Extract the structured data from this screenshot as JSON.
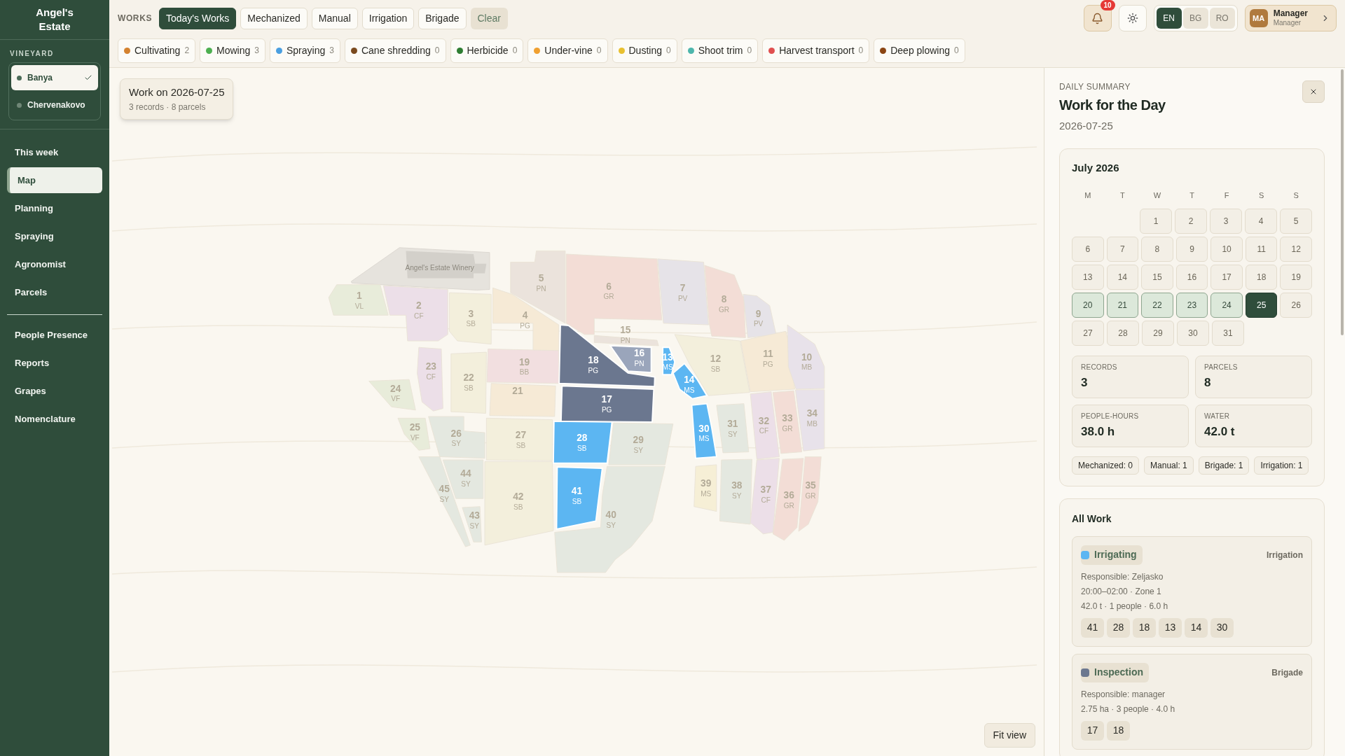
{
  "sidebar": {
    "brand": "Angel's Estate",
    "vineyard_label": "VINEYARD",
    "vineyards": [
      {
        "name": "Banya",
        "selected": true
      },
      {
        "name": "Chervenakovo",
        "selected": false
      }
    ],
    "nav_groups": [
      [
        {
          "label": "This week",
          "selected": false
        },
        {
          "label": "Map",
          "selected": true
        },
        {
          "label": "Planning",
          "selected": false
        },
        {
          "label": "Spraying",
          "selected": false
        },
        {
          "label": "Agronomist",
          "selected": false
        },
        {
          "label": "Parcels",
          "selected": false
        }
      ],
      [
        {
          "label": "People Presence",
          "selected": false
        },
        {
          "label": "Reports",
          "selected": false
        },
        {
          "label": "Grapes",
          "selected": false
        },
        {
          "label": "Nomenclature",
          "selected": false
        }
      ]
    ]
  },
  "topbar": {
    "works_label": "WORKS",
    "filters": [
      {
        "label": "Today's Works",
        "selected": true
      },
      {
        "label": "Mechanized",
        "selected": false
      },
      {
        "label": "Manual",
        "selected": false
      },
      {
        "label": "Irrigation",
        "selected": false
      },
      {
        "label": "Brigade",
        "selected": false
      }
    ],
    "clear": "Clear",
    "notifications": "10",
    "languages": [
      {
        "label": "EN",
        "selected": true
      },
      {
        "label": "BG",
        "selected": false
      },
      {
        "label": "RO",
        "selected": false
      }
    ],
    "user": {
      "initials": "MA",
      "name": "Manager",
      "role": "Manager"
    }
  },
  "categories": [
    {
      "label": "Cultivating",
      "count": "2",
      "color": "#d4822f"
    },
    {
      "label": "Mowing",
      "count": "3",
      "color": "#4caf50"
    },
    {
      "label": "Spraying",
      "count": "3",
      "color": "#4a9fe0"
    },
    {
      "label": "Cane shredding",
      "count": "0",
      "color": "#7a4a1e"
    },
    {
      "label": "Herbicide",
      "count": "0",
      "color": "#2e7d32"
    },
    {
      "label": "Under-vine",
      "count": "0",
      "color": "#f0a030"
    },
    {
      "label": "Dusting",
      "count": "0",
      "color": "#e8c030"
    },
    {
      "label": "Shoot trim",
      "count": "0",
      "color": "#4db6ac"
    },
    {
      "label": "Harvest transport",
      "count": "0",
      "color": "#e05050"
    },
    {
      "label": "Deep plowing",
      "count": "0",
      "color": "#8b4513"
    }
  ],
  "map": {
    "banner": {
      "title": "Work on 2026-07-25",
      "subtitle": "3 records · 8 parcels"
    },
    "winery": "Angel's Estate Winery",
    "parcels": [
      {
        "number": "1",
        "variety": "VL",
        "color": "#e8ecda",
        "active": false
      },
      {
        "number": "2",
        "variety": "CF",
        "color": "#ecdfe8",
        "active": false
      },
      {
        "number": "3",
        "variety": "SB",
        "color": "#f3efdc",
        "active": false
      },
      {
        "number": "4",
        "variety": "PG",
        "color": "#f6ead6",
        "active": false
      },
      {
        "number": "5",
        "variety": "PN",
        "color": "#ebe3dc",
        "active": false
      },
      {
        "number": "6",
        "variety": "GR",
        "color": "#f3ddd6",
        "active": false
      },
      {
        "number": "7",
        "variety": "PV",
        "color": "#e6e3e8",
        "active": false
      },
      {
        "number": "8",
        "variety": "GR",
        "color": "#f3ddd6",
        "active": false
      },
      {
        "number": "9",
        "variety": "PV",
        "color": "#e6e3e8",
        "active": false
      },
      {
        "number": "13",
        "variety": "MS",
        "color": "#5cb6f2",
        "active": true
      },
      {
        "number": "12",
        "variety": "SB",
        "color": "#f3efdc",
        "active": false
      },
      {
        "number": "11",
        "variety": "PG",
        "color": "#f6ead6",
        "active": false
      },
      {
        "number": "10",
        "variety": "MB",
        "color": "#e8e2ea",
        "active": false
      },
      {
        "number": "14",
        "variety": "MS",
        "color": "#5cb6f2",
        "active": true
      },
      {
        "number": "15",
        "variety": "PN",
        "color": "#ebe3dc",
        "active": false
      },
      {
        "number": "16",
        "variety": "PN",
        "color": "#9aa5bb",
        "active": true
      },
      {
        "number": "17",
        "variety": "PG",
        "color": "#6b778f",
        "active": true
      },
      {
        "number": "19",
        "variety": "BB",
        "color": "#f2dfe0",
        "active": false
      },
      {
        "number": "18",
        "variety": "PG",
        "color": "#6b778f",
        "active": true
      },
      {
        "number": "21",
        "color": "#f6ead6",
        "active": false
      },
      {
        "number": "22",
        "variety": "SB",
        "color": "#f3efdc",
        "active": false
      },
      {
        "number": "23",
        "variety": "CF",
        "color": "#ecdfe8",
        "active": false
      },
      {
        "number": "24",
        "variety": "VF",
        "color": "#e8ecda",
        "active": false
      },
      {
        "number": "25",
        "variety": "VF",
        "color": "#e8ecda",
        "active": false
      },
      {
        "number": "26",
        "variety": "SY",
        "color": "#e4e8e0",
        "active": false
      },
      {
        "number": "27",
        "variety": "SB",
        "color": "#f3efdc",
        "active": false
      },
      {
        "number": "28",
        "variety": "SB",
        "color": "#5cb6f2",
        "active": true
      },
      {
        "number": "29",
        "variety": "SY",
        "color": "#e4e8e0",
        "active": false
      },
      {
        "number": "30",
        "variety": "MS",
        "color": "#5cb6f2",
        "active": true
      },
      {
        "number": "31",
        "variety": "SY",
        "color": "#e4e8e0",
        "active": false
      },
      {
        "number": "32",
        "variety": "CF",
        "color": "#ecdfe8",
        "active": false
      },
      {
        "number": "33",
        "variety": "GR",
        "color": "#f3ddd6",
        "active": false
      },
      {
        "number": "34",
        "variety": "MB",
        "color": "#e8e2ea",
        "active": false
      },
      {
        "number": "45",
        "variety": "SY",
        "color": "#e4e8e0",
        "active": false
      },
      {
        "number": "44",
        "variety": "SY",
        "color": "#e4e8e0",
        "active": false
      },
      {
        "number": "43",
        "variety": "SY",
        "color": "#e4e8e0",
        "active": false
      },
      {
        "number": "42",
        "variety": "SB",
        "color": "#f3efdc",
        "active": false
      },
      {
        "number": "41",
        "variety": "SB",
        "color": "#5cb6f2",
        "active": true
      },
      {
        "number": "40",
        "variety": "SY",
        "color": "#e4e8e0",
        "active": false
      },
      {
        "number": "39",
        "variety": "MS",
        "color": "#f6efd6",
        "active": false
      },
      {
        "number": "38",
        "variety": "SY",
        "color": "#e4e8e0",
        "active": false
      },
      {
        "number": "37",
        "variety": "CF",
        "color": "#ecdfe8",
        "active": false
      },
      {
        "number": "36",
        "variety": "GR",
        "color": "#f3ddd6",
        "active": false
      },
      {
        "number": "35",
        "variety": "GR",
        "color": "#f3ddd6",
        "active": false
      }
    ],
    "fit_button": "Fit view"
  },
  "summary": {
    "eyebrow": "DAILY SUMMARY",
    "title": "Work for the Day",
    "date": "2026-07-25",
    "calendar": {
      "month": "July 2026",
      "weekdays": [
        "M",
        "T",
        "W",
        "T",
        "F",
        "S",
        "S"
      ],
      "weeks": [
        [
          {
            "day": "1",
            "selected": false,
            "in_week": false
          },
          {
            "day": "2",
            "selected": false,
            "in_week": false
          },
          {
            "day": "3",
            "selected": false,
            "in_week": false
          },
          {
            "day": "4",
            "selected": false,
            "in_week": false
          },
          {
            "day": "5",
            "selected": false,
            "in_week": false
          }
        ],
        [
          {
            "day": "6",
            "selected": false,
            "in_week": false
          },
          {
            "day": "7",
            "selected": false,
            "in_week": false
          },
          {
            "day": "8",
            "selected": false,
            "in_week": false
          },
          {
            "day": "9",
            "selected": false,
            "in_week": false
          },
          {
            "day": "10",
            "selected": false,
            "in_week": false
          },
          {
            "day": "11",
            "selected": false,
            "in_week": false
          },
          {
            "day": "12",
            "selected": false,
            "in_week": false
          }
        ],
        [
          {
            "day": "13",
            "selected": false,
            "in_week": false
          },
          {
            "day": "14",
            "selected": false,
            "in_week": false
          },
          {
            "day": "15",
            "selected": false,
            "in_week": false
          },
          {
            "day": "16",
            "selected": false,
            "in_week": false
          },
          {
            "day": "17",
            "selected": false,
            "in_week": false
          },
          {
            "day": "18",
            "selected": false,
            "in_week": false
          },
          {
            "day": "19",
            "selected": false,
            "in_week": false
          }
        ],
        [
          {
            "day": "20",
            "selected": false,
            "in_week": true
          },
          {
            "day": "21",
            "selected": false,
            "in_week": true
          },
          {
            "day": "22",
            "selected": false,
            "in_week": true
          },
          {
            "day": "23",
            "selected": false,
            "in_week": true
          },
          {
            "day": "24",
            "selected": false,
            "in_week": true
          },
          {
            "day": "25",
            "selected": true,
            "in_week": true
          },
          {
            "day": "26",
            "selected": false,
            "in_week": false
          }
        ],
        [
          {
            "day": "27",
            "selected": false,
            "in_week": false
          },
          {
            "day": "28",
            "selected": false,
            "in_week": false
          },
          {
            "day": "29",
            "selected": false,
            "in_week": false
          },
          {
            "day": "30",
            "selected": false,
            "in_week": false
          },
          {
            "day": "31",
            "selected": false,
            "in_week": false
          }
        ]
      ]
    },
    "stats": [
      {
        "label": "RECORDS",
        "value": "3"
      },
      {
        "label": "PARCELS",
        "value": "8"
      },
      {
        "label": "PEOPLE-HOURS",
        "value": "38.0 h"
      },
      {
        "label": "WATER",
        "value": "42.0 t"
      }
    ],
    "tags": [
      "Mechanized: 0",
      "Manual: 1",
      "Brigade: 1",
      "Irrigation: 1"
    ],
    "all_work": {
      "title": "All Work",
      "items": [
        {
          "name": "Irrigating",
          "color": "#5cb6f2",
          "type": "Irrigation",
          "lines": [
            "Responsible: Zeljasko",
            "20:00–02:00 · Zone 1",
            "42.0 t · 1 people · 6.0 h"
          ],
          "parcels": [
            "41",
            "28",
            "18",
            "13",
            "14",
            "30"
          ]
        },
        {
          "name": "Inspection",
          "color": "#6b778f",
          "type": "Brigade",
          "lines": [
            "Responsible: manager",
            "2.75 ha · 3 people · 4.0 h"
          ],
          "parcels": [
            "17",
            "18"
          ]
        }
      ]
    }
  }
}
